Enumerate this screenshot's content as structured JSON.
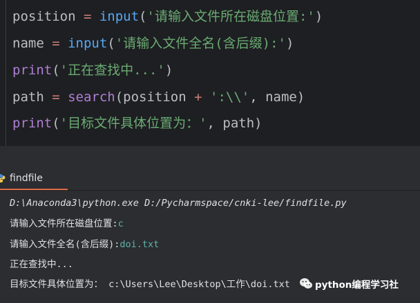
{
  "editor": {
    "lines": [
      {
        "tokens": [
          {
            "text": "position",
            "kind": "var"
          },
          {
            "text": " = ",
            "kind": "op"
          },
          {
            "text": "input",
            "kind": "fn"
          },
          {
            "text": "(",
            "kind": "punc"
          },
          {
            "text": "'请输入文件所在磁盘位置:'",
            "kind": "str"
          },
          {
            "text": ")",
            "kind": "punc"
          }
        ]
      },
      {
        "tokens": [
          {
            "text": "name",
            "kind": "var"
          },
          {
            "text": " = ",
            "kind": "op"
          },
          {
            "text": "input",
            "kind": "fn"
          },
          {
            "text": "(",
            "kind": "punc"
          },
          {
            "text": "'请输入文件全名(含后缀):'",
            "kind": "str"
          },
          {
            "text": ")",
            "kind": "punc"
          }
        ]
      },
      {
        "tokens": [
          {
            "text": "print",
            "kind": "builtin"
          },
          {
            "text": "(",
            "kind": "punc"
          },
          {
            "text": "'正在查找中...'",
            "kind": "str"
          },
          {
            "text": ")",
            "kind": "punc"
          }
        ]
      },
      {
        "tokens": [
          {
            "text": "path",
            "kind": "var"
          },
          {
            "text": " = ",
            "kind": "op"
          },
          {
            "text": "search",
            "kind": "builtin"
          },
          {
            "text": "(position ",
            "kind": "punc"
          },
          {
            "text": "+",
            "kind": "op"
          },
          {
            "text": " ",
            "kind": "punc"
          },
          {
            "text": "':\\\\'",
            "kind": "str"
          },
          {
            "text": ", name)",
            "kind": "punc"
          }
        ]
      },
      {
        "tokens": [
          {
            "text": "print",
            "kind": "builtin"
          },
          {
            "text": "(",
            "kind": "punc"
          },
          {
            "text": "'目标文件具体位置为：'",
            "kind": "str"
          },
          {
            "text": ", path)",
            "kind": "punc"
          }
        ]
      }
    ]
  },
  "run_tab": {
    "label": "findfile",
    "icon": "python-icon"
  },
  "console": {
    "command": "D:\\Anaconda3\\python.exe D:/Pycharmspace/cnki-lee/findfile.py",
    "prompt1": "请输入文件所在磁盘位置:",
    "input1": "c",
    "prompt2": "请输入文件全名(含后缀):",
    "input2": "doi.txt",
    "searching": "正在查找中...",
    "result_label": "目标文件具体位置为：",
    "result_path": " c:\\Users\\Lee\\Desktop\\工作\\doi.txt"
  },
  "watermark": {
    "text": "python编程学习社",
    "icon": "wechat-icon"
  },
  "colors": {
    "editor_bg": "#1e1f22",
    "panel_bg": "#2b2d30",
    "string": "#6aab73",
    "function": "#56a8f5",
    "builtin": "#b07fd4",
    "operator": "#ce7f78",
    "input_text": "#5fb4ac",
    "tab_underline": "#e06c4c"
  }
}
